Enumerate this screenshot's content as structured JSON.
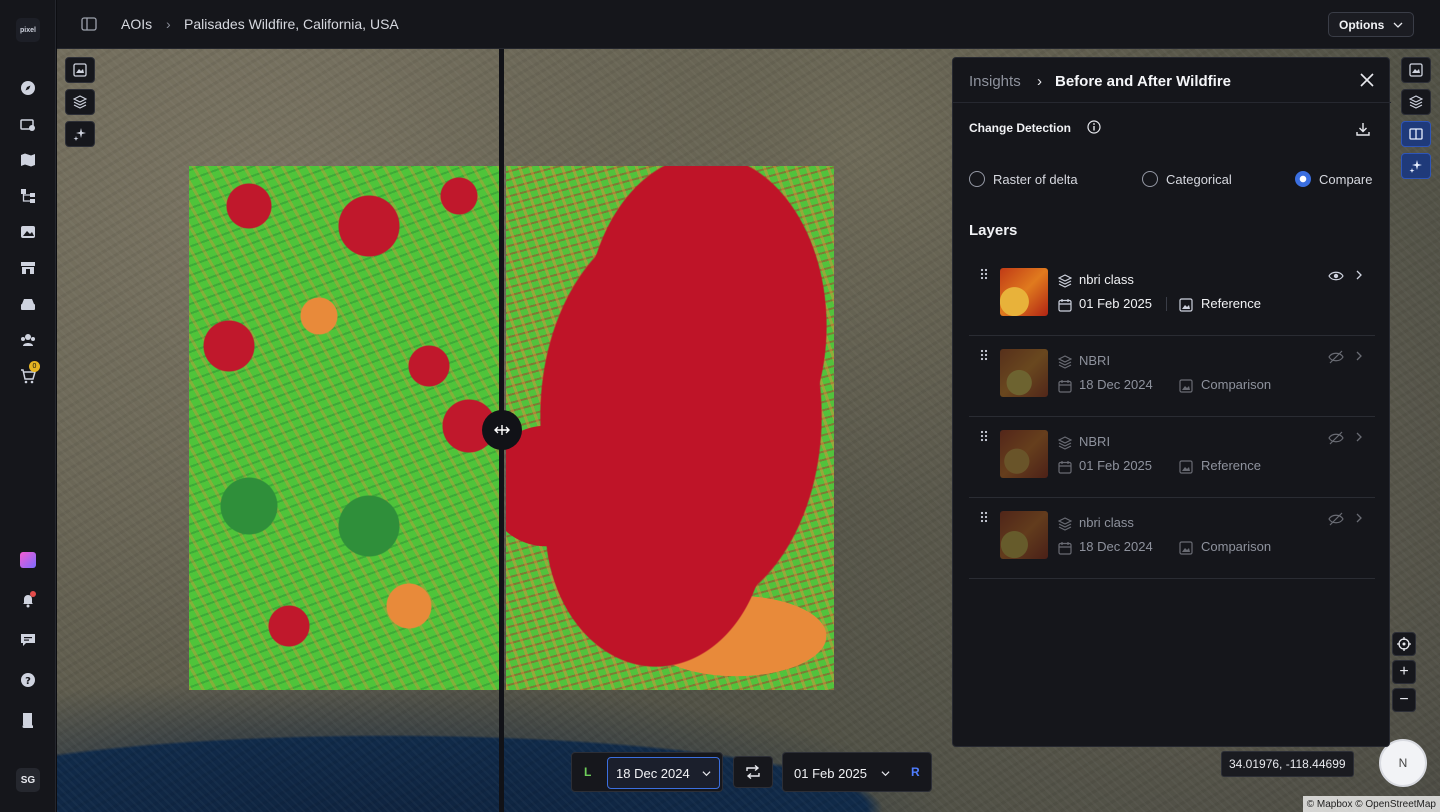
{
  "app": {
    "logo_text": "pixel",
    "avatar_initials": "SG",
    "cart_count": "0"
  },
  "breadcrumb": {
    "root": "AOIs",
    "current": "Palisades Wildfire, California, USA"
  },
  "topbar": {
    "options_label": "Options"
  },
  "map": {
    "coords": "34.01976, -118.44699",
    "compass_label": "N",
    "attribution": "© Mapbox © OpenStreetMap",
    "zoom_in": "+",
    "zoom_out": "−"
  },
  "date_compare": {
    "left_label": "L",
    "left_date": "18 Dec 2024",
    "right_label": "R",
    "right_date": "01 Feb 2025"
  },
  "panel": {
    "crumb_root": "Insights",
    "crumb_current": "Before and After Wildfire",
    "section_title": "Change Detection",
    "modes": [
      {
        "label": "Raster of delta",
        "selected": false
      },
      {
        "label": "Categorical",
        "selected": false
      },
      {
        "label": "Compare",
        "selected": true
      }
    ],
    "layers_title": "Layers",
    "layers": [
      {
        "name": "nbri class",
        "date": "01 Feb 2025",
        "role": "Reference",
        "visible": true
      },
      {
        "name": "NBRI",
        "date": "18 Dec 2024",
        "role": "Comparison",
        "visible": false
      },
      {
        "name": "NBRI",
        "date": "01 Feb 2025",
        "role": "Reference",
        "visible": false
      },
      {
        "name": "nbri class",
        "date": "18 Dec 2024",
        "role": "Comparison",
        "visible": false
      }
    ]
  },
  "colors": {
    "accent": "#3b6fe0",
    "burn_red": "#bf1428",
    "veg_green": "#4fc43a",
    "moderate_orange": "#e88a3a",
    "left_label": "#6fcf5a",
    "right_label": "#4f7dff"
  }
}
